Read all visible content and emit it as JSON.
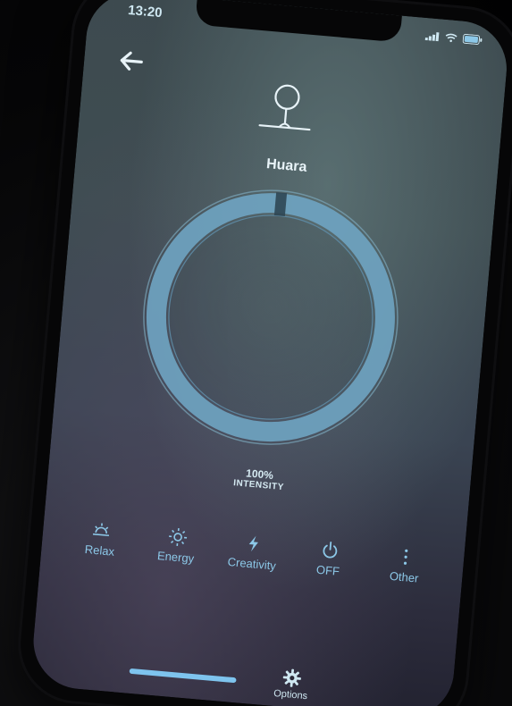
{
  "status_bar": {
    "time": "13:20"
  },
  "header": {
    "back_icon": "arrow-left-icon",
    "device_icon": "lamp-icon",
    "device_name": "Huara"
  },
  "dial": {
    "intensity_value": "100%",
    "intensity_label": "INTENSITY",
    "level_percent": 100
  },
  "modes": [
    {
      "label": "Relax",
      "icon": "sunset-icon"
    },
    {
      "label": "Energy",
      "icon": "sun-icon"
    },
    {
      "label": "Creativity",
      "icon": "lightning-icon"
    },
    {
      "label": "OFF",
      "icon": "power-icon"
    },
    {
      "label": "Other",
      "icon": "more-vertical-icon"
    }
  ],
  "footer": {
    "options_label": "Options",
    "options_icon": "gear-icon"
  },
  "colors": {
    "accent": "#7ec4ee",
    "dial_ring": "#6fa4c2",
    "text": "#e8f3f8"
  }
}
